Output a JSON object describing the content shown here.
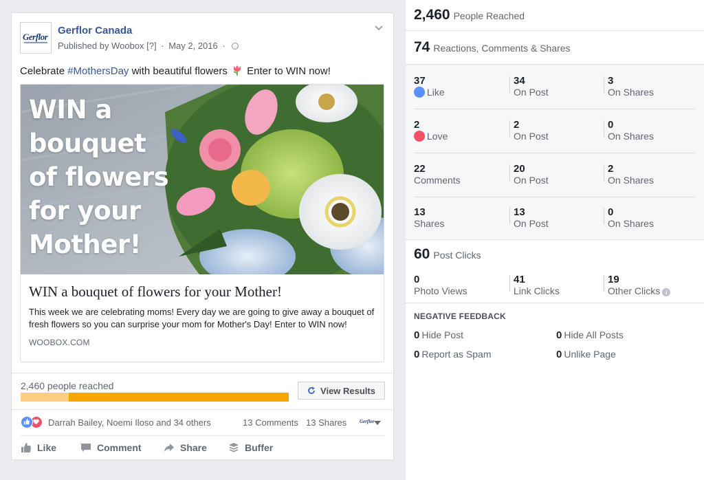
{
  "post": {
    "page_name": "Gerflor Canada",
    "avatar_text": "Gerflor",
    "published_by": "Published by Woobox",
    "help_marker": "[?]",
    "date": "May 2, 2016",
    "text_before": "Celebrate ",
    "hashtag": "#MothersDay",
    "text_after": " with beautiful flowers",
    "text_end": " Enter to WIN now!",
    "image_text": "WIN a bouquet of flowers for your Mother!",
    "card_title": "WIN a bouquet of flowers for your Mother!",
    "card_description": "This week we are celebrating moms! Every day we are going to give away a bouquet of fresh flowers so you can surprise your mom for Mother's Day! Enter to WIN now!",
    "card_domain": "WOOBOX.COM",
    "people_reached": "2,460 people reached",
    "reach_fraction": 0.18,
    "view_results_label": "View Results",
    "reactors": "Darrah Bailey, Noemi Iloso and 34 others",
    "comments": "13 Comments",
    "shares": "13 Shares",
    "mini_logo": "Gerflor",
    "actions": {
      "like": "Like",
      "comment": "Comment",
      "share": "Share",
      "buffer": "Buffer"
    }
  },
  "insights": {
    "reached": {
      "value": "2,460",
      "label": "People Reached"
    },
    "engagement": {
      "value": "74",
      "label": "Reactions, Comments & Shares"
    },
    "rows": [
      {
        "total": "37",
        "label": "Like",
        "on_post": "34",
        "on_shares": "3"
      },
      {
        "total": "2",
        "label": "Love",
        "on_post": "2",
        "on_shares": "0"
      },
      {
        "total": "22",
        "label": "Comments",
        "on_post": "20",
        "on_shares": "2"
      },
      {
        "total": "13",
        "label": "Shares",
        "on_post": "13",
        "on_shares": "0"
      }
    ],
    "on_post_label": "On Post",
    "on_shares_label": "On Shares",
    "post_clicks": {
      "value": "60",
      "label": "Post Clicks"
    },
    "clicks": [
      {
        "value": "0",
        "label": "Photo Views"
      },
      {
        "value": "41",
        "label": "Link Clicks"
      },
      {
        "value": "19",
        "label": "Other Clicks"
      }
    ],
    "negative_title": "NEGATIVE FEEDBACK",
    "negative": [
      {
        "value": "0",
        "label": "Hide Post"
      },
      {
        "value": "0",
        "label": "Hide All Posts"
      },
      {
        "value": "0",
        "label": "Report as Spam"
      },
      {
        "value": "0",
        "label": "Unlike Page"
      }
    ]
  },
  "colors": {
    "link": "#365899",
    "progress": "#f7a600",
    "progress_light": "#ffcc80",
    "like": "#5890ff",
    "love": "#f25268"
  }
}
